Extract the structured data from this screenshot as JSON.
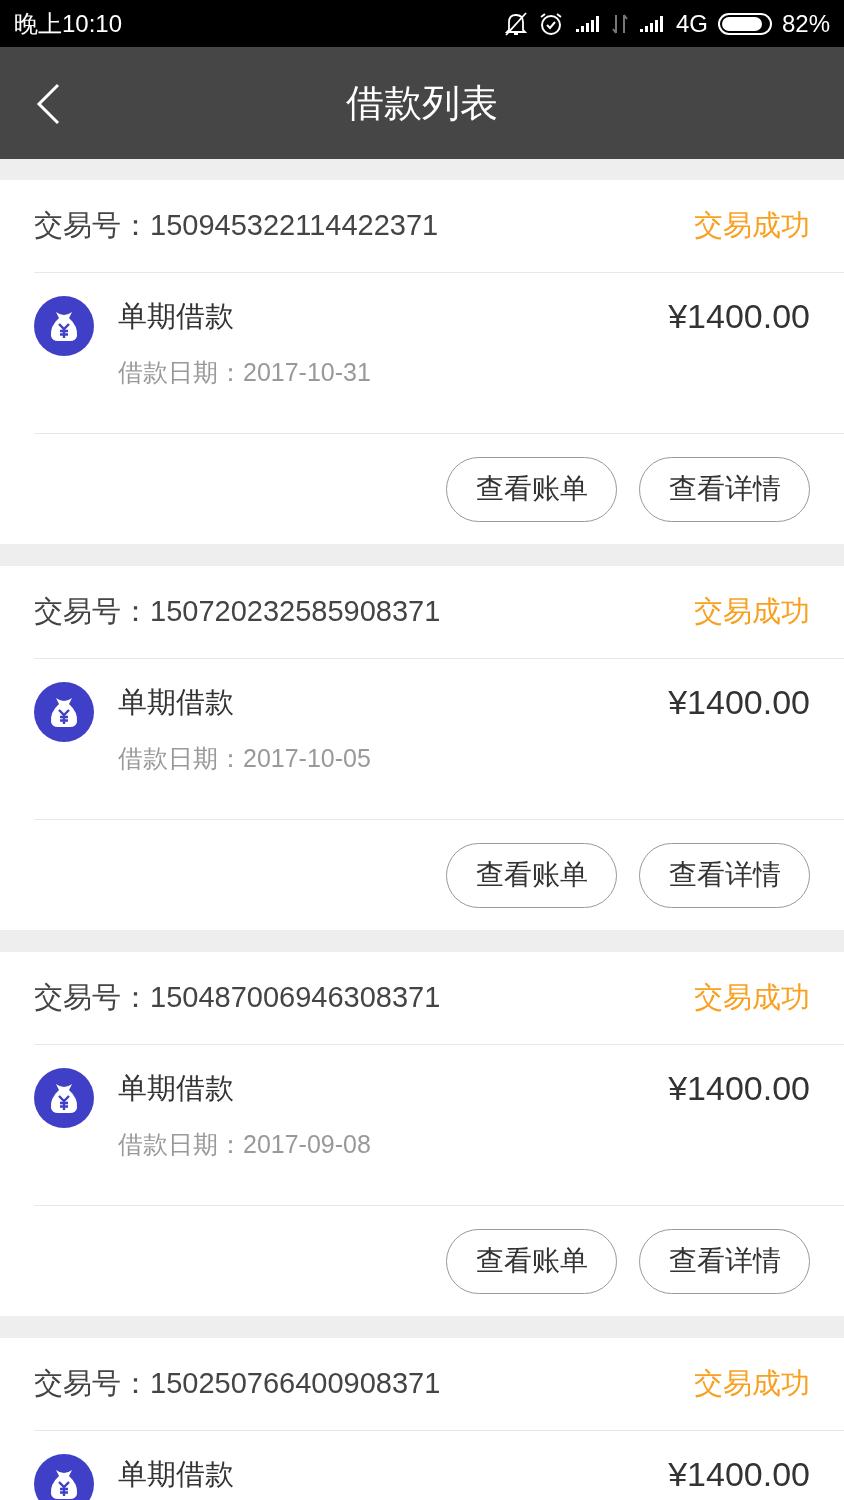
{
  "status_bar": {
    "time": "晚上10:10",
    "network": "4G",
    "battery": "82%"
  },
  "nav": {
    "title": "借款列表"
  },
  "loans": [
    {
      "trade_no": "交易号：150945322114422371",
      "status": "交易成功",
      "color": "#f8a020",
      "title": "单期借款",
      "date": "借款日期：2017-10-31",
      "amount": "¥1400.00",
      "buttons": [
        "查看账单",
        "查看详情"
      ]
    },
    {
      "trade_no": "交易号：150720232585908371",
      "status": "交易成功",
      "color": "#f8a020",
      "title": "单期借款",
      "date": "借款日期：2017-10-05",
      "amount": "¥1400.00",
      "buttons": [
        "查看账单",
        "查看详情"
      ]
    },
    {
      "trade_no": "交易号：150487006946308371",
      "status": "交易成功",
      "color": "#f8a020",
      "title": "单期借款",
      "date": "借款日期：2017-09-08",
      "amount": "¥1400.00",
      "buttons": [
        "查看账单",
        "查看详情"
      ]
    },
    {
      "trade_no": "交易号：150250766400908371",
      "status": "交易成功",
      "color": "#f8a020",
      "title": "单期借款",
      "amount": "¥1400.00"
    }
  ]
}
